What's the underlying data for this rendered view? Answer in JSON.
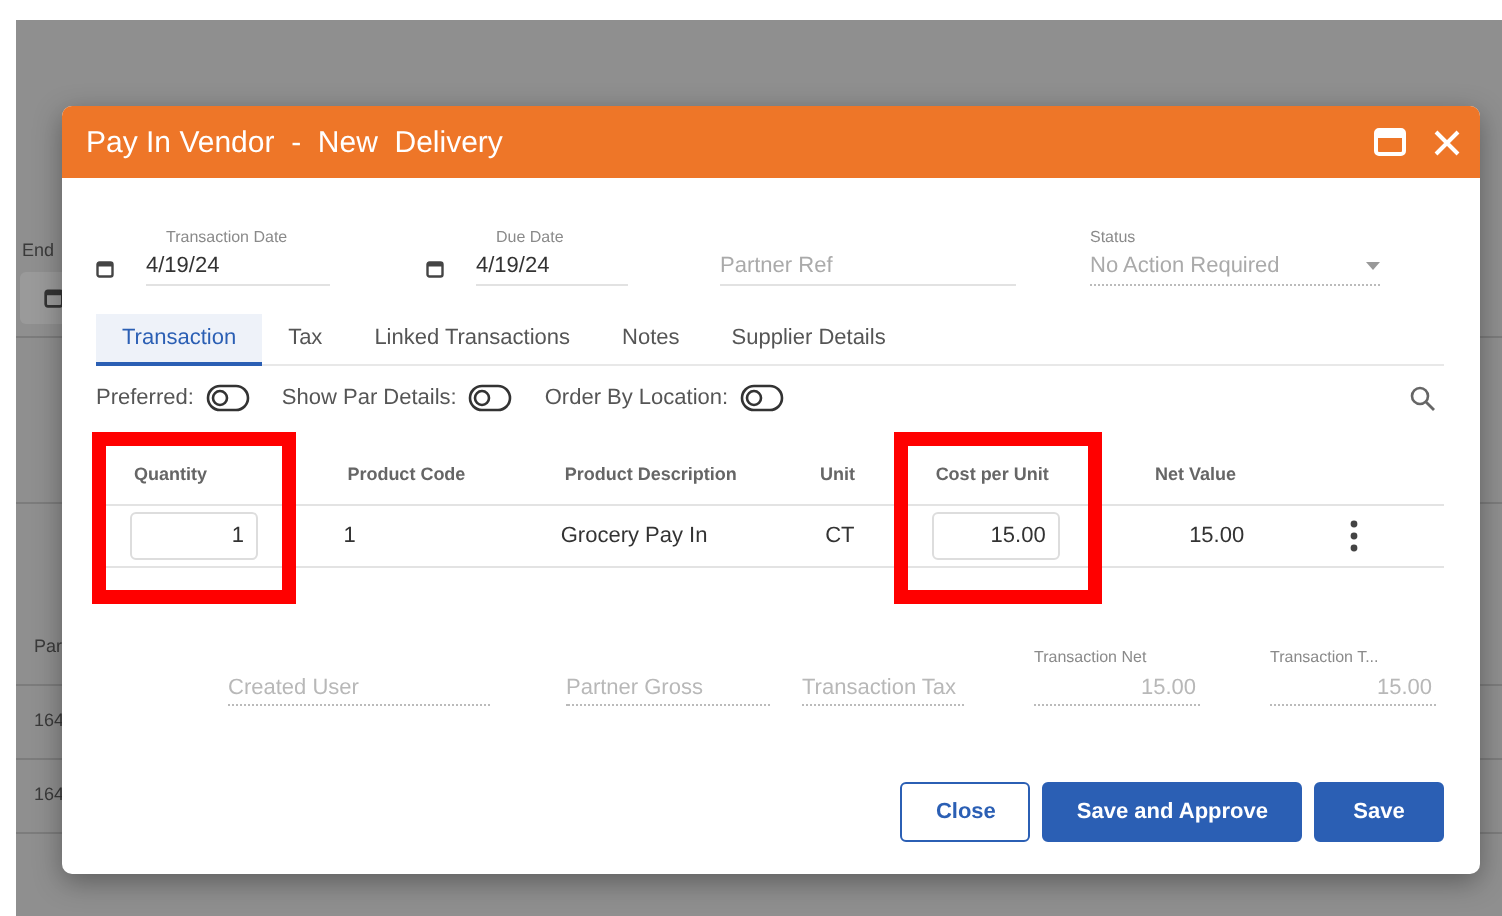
{
  "window": {
    "title": "Pay In Vendor  -  New  Delivery"
  },
  "background": {
    "field_label": "End",
    "column_label": "Par",
    "rows": [
      "164",
      "164"
    ]
  },
  "header_fields": {
    "transaction_date": {
      "label": "Transaction Date",
      "value": "4/19/24"
    },
    "due_date": {
      "label": "Due Date",
      "value": "4/19/24"
    },
    "partner_ref": {
      "placeholder": "Partner Ref"
    },
    "status": {
      "label": "Status",
      "value": "No Action Required"
    }
  },
  "tabs": [
    {
      "label": "Transaction",
      "selected": true
    },
    {
      "label": "Tax",
      "selected": false
    },
    {
      "label": "Linked Transactions",
      "selected": false
    },
    {
      "label": "Notes",
      "selected": false
    },
    {
      "label": "Supplier Details",
      "selected": false
    }
  ],
  "toggles": [
    {
      "label": "Preferred:",
      "on": false
    },
    {
      "label": "Show Par Details:",
      "on": false
    },
    {
      "label": "Order By Location:",
      "on": false
    }
  ],
  "table": {
    "columns": [
      {
        "label": "Quantity",
        "highlighted": true
      },
      {
        "label": "Product Code",
        "highlighted": false
      },
      {
        "label": "Product Description",
        "highlighted": false
      },
      {
        "label": "Unit",
        "highlighted": false
      },
      {
        "label": "Cost per Unit",
        "highlighted": true
      },
      {
        "label": "Net Value",
        "highlighted": false
      }
    ],
    "rows": [
      {
        "cells": [
          {
            "kind": "input",
            "text": "1"
          },
          {
            "kind": "text",
            "text": "1"
          },
          {
            "kind": "text",
            "text": "Grocery Pay In"
          },
          {
            "kind": "center",
            "text": "CT"
          },
          {
            "kind": "input",
            "text": "15.00"
          },
          {
            "kind": "center",
            "text": "15.00"
          }
        ]
      }
    ]
  },
  "totals": [
    {
      "kind": "placeholder",
      "placeholder": "Created User"
    },
    {
      "kind": "placeholder",
      "placeholder": "Partner Gross"
    },
    {
      "kind": "placeholder",
      "placeholder": "Transaction Tax"
    },
    {
      "kind": "value",
      "label": "Transaction Net",
      "value": "15.00"
    },
    {
      "kind": "value",
      "label": "Transaction T...",
      "value": "15.00"
    }
  ],
  "buttons": [
    {
      "label": "Close",
      "kind": "outline"
    },
    {
      "label": "Save and Approve",
      "kind": "primary"
    },
    {
      "label": "Save",
      "kind": "primary"
    }
  ]
}
